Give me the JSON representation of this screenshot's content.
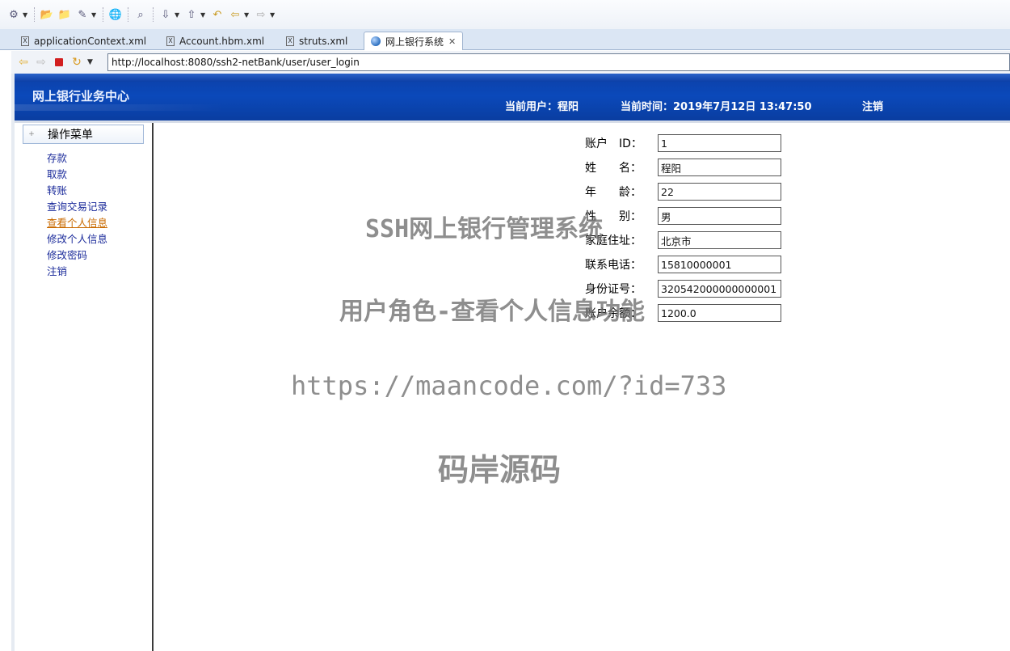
{
  "ide": {
    "tabs": [
      {
        "label": "applicationContext.xml"
      },
      {
        "label": "Account.hbm.xml"
      },
      {
        "label": "struts.xml"
      },
      {
        "label": "网上银行系统"
      }
    ]
  },
  "browser": {
    "url": "http://localhost:8080/ssh2-netBank/user/user_login"
  },
  "banner": {
    "title": "网上银行业务中心",
    "current_user": "当前用户：程阳",
    "current_time": "当前时间：2019年7月12日 13:47:50",
    "logout": "注销"
  },
  "sidebar": {
    "header": "操作菜单",
    "items": [
      {
        "label": "存款"
      },
      {
        "label": "取款"
      },
      {
        "label": "转账"
      },
      {
        "label": "查询交易记录"
      },
      {
        "label": "查看个人信息"
      },
      {
        "label": "修改个人信息"
      },
      {
        "label": "修改密码"
      },
      {
        "label": "注销"
      }
    ],
    "active_item": "查看个人信息"
  },
  "form": {
    "fields": [
      {
        "label": "账户　ID：",
        "value": "1"
      },
      {
        "label": "姓　　名：",
        "value": "程阳"
      },
      {
        "label": "年　　龄：",
        "value": "22"
      },
      {
        "label": "性　　别：",
        "value": "男"
      },
      {
        "label": "家庭住址：",
        "value": "北京市"
      },
      {
        "label": "联系电话：",
        "value": "15810000001"
      },
      {
        "label": "身份证号：",
        "value": "320542000000000001"
      },
      {
        "label": "账户余额：",
        "value": "1200.0"
      }
    ]
  },
  "watermark": {
    "line1": "SSH网上银行管理系统",
    "line2": "用户角色-查看个人信息功能",
    "line3": "https://maancode.com/?id=733",
    "line4": "码岸源码"
  },
  "colors": {
    "banner": "#0b49ba",
    "menu_link": "#1a2a9a",
    "menu_active": "#c96a00"
  }
}
